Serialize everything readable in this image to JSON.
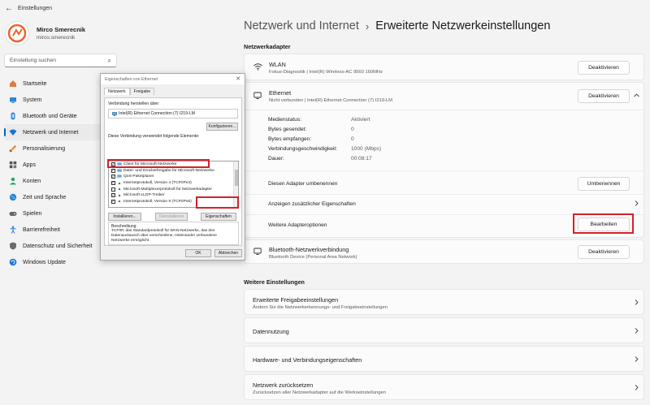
{
  "app": {
    "title": "Einstellungen",
    "back_icon": "back-arrow-icon"
  },
  "profile": {
    "name": "Mirco Smerecnik",
    "email": "mirco.smerecnik"
  },
  "search": {
    "placeholder": "Einstellung suchen"
  },
  "sidebar": {
    "items": [
      {
        "label": "Startseite",
        "icon": "home-icon"
      },
      {
        "label": "System",
        "icon": "monitor-icon"
      },
      {
        "label": "Bluetooth und Geräte",
        "icon": "bluetooth-icon"
      },
      {
        "label": "Netzwerk und Internet",
        "icon": "wifi-icon",
        "active": true
      },
      {
        "label": "Personalisierung",
        "icon": "brush-icon"
      },
      {
        "label": "Apps",
        "icon": "apps-icon"
      },
      {
        "label": "Konten",
        "icon": "person-icon"
      },
      {
        "label": "Zeit und Sprache",
        "icon": "globe-icon"
      },
      {
        "label": "Spielen",
        "icon": "gamepad-icon"
      },
      {
        "label": "Barrierefreiheit",
        "icon": "accessibility-icon"
      },
      {
        "label": "Datenschutz und Sicherheit",
        "icon": "shield-icon"
      },
      {
        "label": "Windows Update",
        "icon": "update-icon"
      }
    ]
  },
  "breadcrumb": {
    "parent": "Netzwerk und Internet",
    "separator": "›",
    "current": "Erweiterte Netzwerkeinstellungen"
  },
  "adapters": {
    "section_title": "Netzwerkadapter",
    "wlan": {
      "title": "WLAN",
      "subtitle": "Fokus-Diagnostik | Intel(R) Wireless-AC 9560 160MHz",
      "button": "Deaktivieren"
    },
    "ethernet": {
      "title": "Ethernet",
      "subtitle": "Nicht verbunden | Intel(R) Ethernet Connection (7) I219-LM",
      "button": "Deaktivieren",
      "details": [
        {
          "label": "Medienstatus:",
          "value": "Aktiviert"
        },
        {
          "label": "Bytes gesendet:",
          "value": "0"
        },
        {
          "label": "Bytes empfangen:",
          "value": "0"
        },
        {
          "label": "Verbindungsgeschwindigkeit:",
          "value": "1000 (Mbps)"
        },
        {
          "label": "Dauer:",
          "value": "00:08:17"
        }
      ],
      "rename_label": "Diesen Adapter umbenennen",
      "rename_button": "Umbenennen",
      "more_props_label": "Anzeigen zusätzlicher Eigenschaften",
      "options_label": "Weitere Adapteroptionen",
      "options_button": "Bearbeiten"
    },
    "bluetooth": {
      "title": "Bluetooth-Netzwerkverbindung",
      "subtitle": "Bluetooth Device (Personal Area Network)",
      "button": "Deaktivieren"
    }
  },
  "more_settings": {
    "section_title": "Weitere Einstellungen",
    "items": [
      {
        "title": "Erweiterte Freigabeeinstellungen",
        "subtitle": "Ändern Sie die Netzwerkerkennungs- und Freigabeeinstellungen"
      },
      {
        "title": "Datennutzung",
        "subtitle": ""
      },
      {
        "title": "Hardware- und Verbindungseigenschaften",
        "subtitle": ""
      },
      {
        "title": "Netzwerk zurücksetzen",
        "subtitle": "Zurücksetzen aller Netzwerkadapter auf die Werkseinstellungen"
      }
    ]
  },
  "dialog": {
    "title": "Eigenschaften von Ethernet",
    "tabs": [
      "Netzwerk",
      "Freigabe"
    ],
    "connect_using_label": "Verbindung herstellen über:",
    "adapter_name": "Intel(R) Ethernet Connection (7) I219-LM",
    "configure_button": "Konfigurieren...",
    "elements_label": "Diese Verbindung verwendet folgende Elemente:",
    "elements": [
      {
        "label": "Client für Microsoft-Netzwerke",
        "checked": true
      },
      {
        "label": "Datei- und Druckerfreigabe für Microsoft-Netzwerke",
        "checked": true
      },
      {
        "label": "QoS-Paketplaner",
        "checked": true
      },
      {
        "label": "Internetprotokoll, Version 4 (TCP/IPv4)",
        "checked": true
      },
      {
        "label": "Microsoft-Multiplexorprotokoll für Netzwerkadapter",
        "checked": false
      },
      {
        "label": "Microsoft-LLDP-Treiber",
        "checked": true
      },
      {
        "label": "Internetprotokoll, Version 6 (TCP/IPv6)",
        "checked": true
      }
    ],
    "install_button": "Installieren...",
    "uninstall_button": "Deinstallieren",
    "properties_button": "Eigenschaften",
    "description_title": "Beschreibung",
    "description": "TCP/IP, das Standardprotokoll für WAN-Netzwerke, das den Datenaustausch über verschiedene, miteinander verbundene Netzwerke ermöglicht.",
    "ok_button": "OK",
    "cancel_button": "Abbrechen",
    "close_icon": "close-icon"
  },
  "colors": {
    "accent": "#0067c0",
    "highlight": "#d6202a"
  }
}
